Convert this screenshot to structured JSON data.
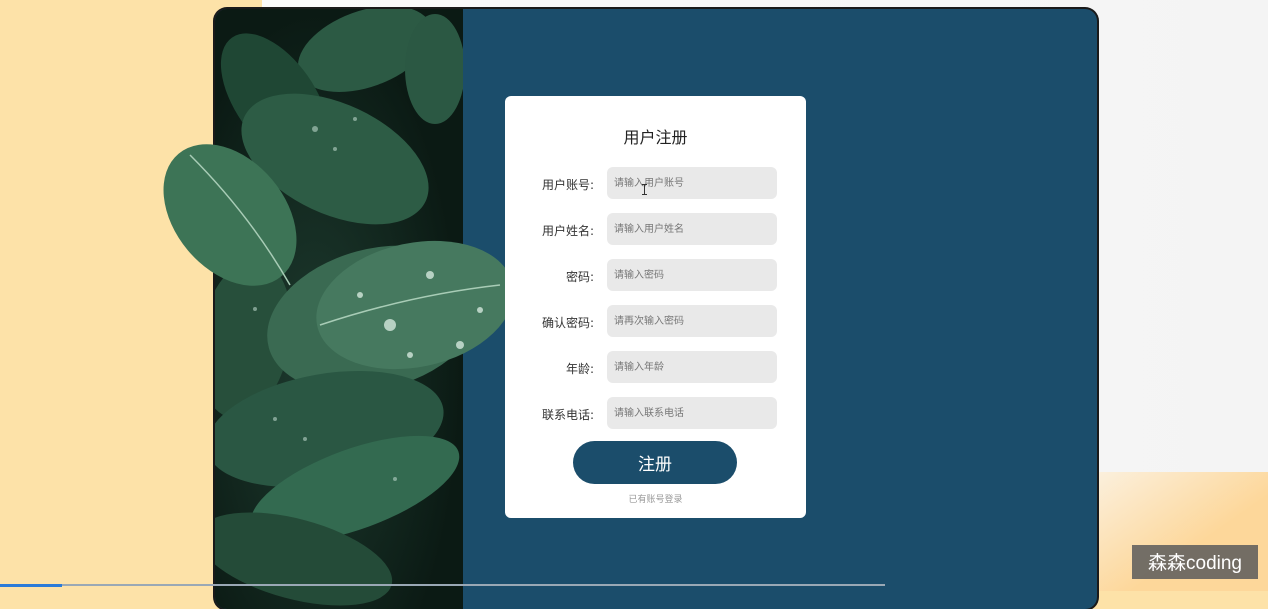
{
  "form": {
    "title": "用户注册",
    "fields": [
      {
        "label": "用户账号:",
        "placeholder": "请输入用户账号",
        "value": ""
      },
      {
        "label": "用户姓名:",
        "placeholder": "请输入用户姓名",
        "value": ""
      },
      {
        "label": "密码:",
        "placeholder": "请输入密码",
        "value": ""
      },
      {
        "label": "确认密码:",
        "placeholder": "请再次输入密码",
        "value": ""
      },
      {
        "label": "年龄:",
        "placeholder": "请输入年龄",
        "value": ""
      },
      {
        "label": "联系电话:",
        "placeholder": "请输入联系电话",
        "value": ""
      }
    ],
    "submit_label": "注册",
    "login_link": "已有账号登录"
  },
  "watermark": "森森coding",
  "colors": {
    "panel": "#1b4d6b",
    "input_bg": "#e9e9e9",
    "page_bg": "#fde2a8"
  }
}
